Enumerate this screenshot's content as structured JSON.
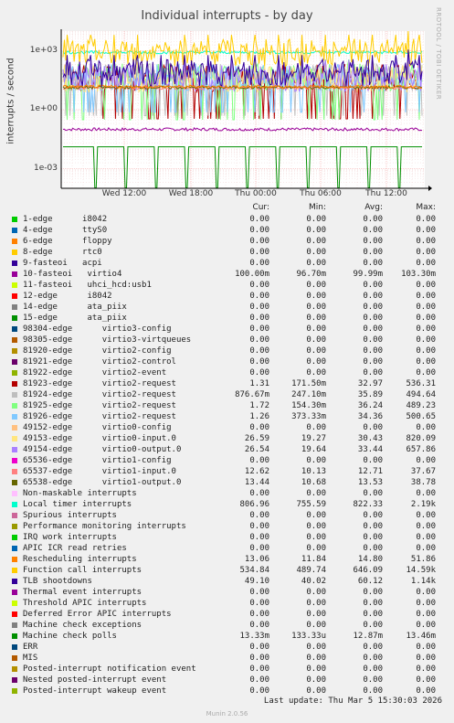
{
  "chart_data": {
    "type": "line",
    "title": "Individual interrupts - by day",
    "ylabel": "interrupts / second",
    "yscale": "log",
    "ylim": [
      0.0001,
      10000
    ],
    "yticks": [
      "1e+03",
      "1e+00",
      "1e-03"
    ],
    "xticks": [
      "Wed 12:00",
      "Wed 18:00",
      "Thu 00:00",
      "Thu 06:00",
      "Thu 12:00"
    ],
    "grid": true,
    "columns": [
      "Cur:",
      "Min:",
      "Avg:",
      "Max:"
    ],
    "series": [
      {
        "name": "1-edge      i8042",
        "color": "#00cc00",
        "values": [
          "0.00",
          "0.00",
          "0.00",
          "0.00"
        ]
      },
      {
        "name": "4-edge      ttyS0",
        "color": "#0066b3",
        "values": [
          "0.00",
          "0.00",
          "0.00",
          "0.00"
        ]
      },
      {
        "name": "6-edge      floppy",
        "color": "#ff8000",
        "values": [
          "0.00",
          "0.00",
          "0.00",
          "0.00"
        ]
      },
      {
        "name": "8-edge      rtc0",
        "color": "#ffcc00",
        "values": [
          "0.00",
          "0.00",
          "0.00",
          "0.00"
        ]
      },
      {
        "name": "9-fasteoi   acpi",
        "color": "#330099",
        "values": [
          "0.00",
          "0.00",
          "0.00",
          "0.00"
        ]
      },
      {
        "name": "10-fasteoi   virtio4",
        "color": "#990099",
        "values": [
          "100.00m",
          "96.70m",
          "99.99m",
          "103.30m"
        ]
      },
      {
        "name": "11-fasteoi   uhci_hcd:usb1",
        "color": "#ccff00",
        "values": [
          "0.00",
          "0.00",
          "0.00",
          "0.00"
        ]
      },
      {
        "name": "12-edge      i8042",
        "color": "#ff0000",
        "values": [
          "0.00",
          "0.00",
          "0.00",
          "0.00"
        ]
      },
      {
        "name": "14-edge      ata_piix",
        "color": "#808080",
        "values": [
          "0.00",
          "0.00",
          "0.00",
          "0.00"
        ]
      },
      {
        "name": "15-edge      ata_piix",
        "color": "#008f00",
        "values": [
          "0.00",
          "0.00",
          "0.00",
          "0.00"
        ]
      },
      {
        "name": "98304-edge      virtio3-config",
        "color": "#00487d",
        "values": [
          "0.00",
          "0.00",
          "0.00",
          "0.00"
        ]
      },
      {
        "name": "98305-edge      virtio3-virtqueues",
        "color": "#b35a00",
        "values": [
          "0.00",
          "0.00",
          "0.00",
          "0.00"
        ]
      },
      {
        "name": "81920-edge      virtio2-config",
        "color": "#b38f00",
        "values": [
          "0.00",
          "0.00",
          "0.00",
          "0.00"
        ]
      },
      {
        "name": "81921-edge      virtio2-control",
        "color": "#6b006b",
        "values": [
          "0.00",
          "0.00",
          "0.00",
          "0.00"
        ]
      },
      {
        "name": "81922-edge      virtio2-event",
        "color": "#8fb300",
        "values": [
          "0.00",
          "0.00",
          "0.00",
          "0.00"
        ]
      },
      {
        "name": "81923-edge      virtio2-request",
        "color": "#b30000",
        "values": [
          "1.31",
          "171.50m",
          "32.97",
          "536.31"
        ]
      },
      {
        "name": "81924-edge      virtio2-request",
        "color": "#bebebe",
        "values": [
          "876.67m",
          "247.10m",
          "35.89",
          "494.64"
        ]
      },
      {
        "name": "81925-edge      virtio2-request",
        "color": "#80ff80",
        "values": [
          "1.72",
          "154.30m",
          "36.24",
          "489.23"
        ]
      },
      {
        "name": "81926-edge      virtio2-request",
        "color": "#80c9ff",
        "values": [
          "1.26",
          "373.33m",
          "34.36",
          "500.65"
        ]
      },
      {
        "name": "49152-edge      virtio0-config",
        "color": "#ffc080",
        "values": [
          "0.00",
          "0.00",
          "0.00",
          "0.00"
        ]
      },
      {
        "name": "49153-edge      virtio0-input.0",
        "color": "#ffe680",
        "values": [
          "26.59",
          "19.27",
          "30.43",
          "820.09"
        ]
      },
      {
        "name": "49154-edge      virtio0-output.0",
        "color": "#aa80ff",
        "values": [
          "26.54",
          "19.64",
          "33.44",
          "657.86"
        ]
      },
      {
        "name": "65536-edge      virtio1-config",
        "color": "#ee00cc",
        "values": [
          "0.00",
          "0.00",
          "0.00",
          "0.00"
        ]
      },
      {
        "name": "65537-edge      virtio1-input.0",
        "color": "#ff8080",
        "values": [
          "12.62",
          "10.13",
          "12.71",
          "37.67"
        ]
      },
      {
        "name": "65538-edge      virtio1-output.0",
        "color": "#666600",
        "values": [
          "13.44",
          "10.68",
          "13.53",
          "38.78"
        ]
      },
      {
        "name": "Non-maskable interrupts",
        "color": "#ffbfff",
        "values": [
          "0.00",
          "0.00",
          "0.00",
          "0.00"
        ]
      },
      {
        "name": "Local timer interrupts",
        "color": "#00ffcc",
        "values": [
          "806.96",
          "755.59",
          "822.33",
          "2.19k"
        ]
      },
      {
        "name": "Spurious interrupts",
        "color": "#cc6699",
        "values": [
          "0.00",
          "0.00",
          "0.00",
          "0.00"
        ]
      },
      {
        "name": "Performance monitoring interrupts",
        "color": "#999900",
        "values": [
          "0.00",
          "0.00",
          "0.00",
          "0.00"
        ]
      },
      {
        "name": "IRQ work interrupts",
        "color": "#00cc00",
        "values": [
          "0.00",
          "0.00",
          "0.00",
          "0.00"
        ]
      },
      {
        "name": "APIC ICR read retries",
        "color": "#0066b3",
        "values": [
          "0.00",
          "0.00",
          "0.00",
          "0.00"
        ]
      },
      {
        "name": "Rescheduling interrupts",
        "color": "#ff8000",
        "values": [
          "13.06",
          "11.84",
          "14.80",
          "51.86"
        ]
      },
      {
        "name": "Function call interrupts",
        "color": "#ffcc00",
        "values": [
          "534.84",
          "489.74",
          "646.09",
          "14.59k"
        ]
      },
      {
        "name": "TLB shootdowns",
        "color": "#330099",
        "values": [
          "49.10",
          "40.02",
          "60.12",
          "1.14k"
        ]
      },
      {
        "name": "Thermal event interrupts",
        "color": "#990099",
        "values": [
          "0.00",
          "0.00",
          "0.00",
          "0.00"
        ]
      },
      {
        "name": "Threshold APIC interrupts",
        "color": "#ccff00",
        "values": [
          "0.00",
          "0.00",
          "0.00",
          "0.00"
        ]
      },
      {
        "name": "Deferred Error APIC interrupts",
        "color": "#ff0000",
        "values": [
          "0.00",
          "0.00",
          "0.00",
          "0.00"
        ]
      },
      {
        "name": "Machine check exceptions",
        "color": "#808080",
        "values": [
          "0.00",
          "0.00",
          "0.00",
          "0.00"
        ]
      },
      {
        "name": "Machine check polls",
        "color": "#008f00",
        "values": [
          "13.33m",
          "133.33u",
          "12.87m",
          "13.46m"
        ]
      },
      {
        "name": "ERR",
        "color": "#00487d",
        "values": [
          "0.00",
          "0.00",
          "0.00",
          "0.00"
        ]
      },
      {
        "name": "MIS",
        "color": "#b35a00",
        "values": [
          "0.00",
          "0.00",
          "0.00",
          "0.00"
        ]
      },
      {
        "name": "Posted-interrupt notification event",
        "color": "#b38f00",
        "values": [
          "0.00",
          "0.00",
          "0.00",
          "0.00"
        ]
      },
      {
        "name": "Nested posted-interrupt event",
        "color": "#6b006b",
        "values": [
          "0.00",
          "0.00",
          "0.00",
          "0.00"
        ]
      },
      {
        "name": "Posted-interrupt wakeup event",
        "color": "#8fb300",
        "values": [
          "0.00",
          "0.00",
          "0.00",
          "0.00"
        ]
      }
    ]
  },
  "side_text": "RRDTOOL / TOBI OETIKER",
  "last_update": "Last update: Thu Mar  5 15:30:03 2026",
  "footer": "Munin 2.0.56"
}
